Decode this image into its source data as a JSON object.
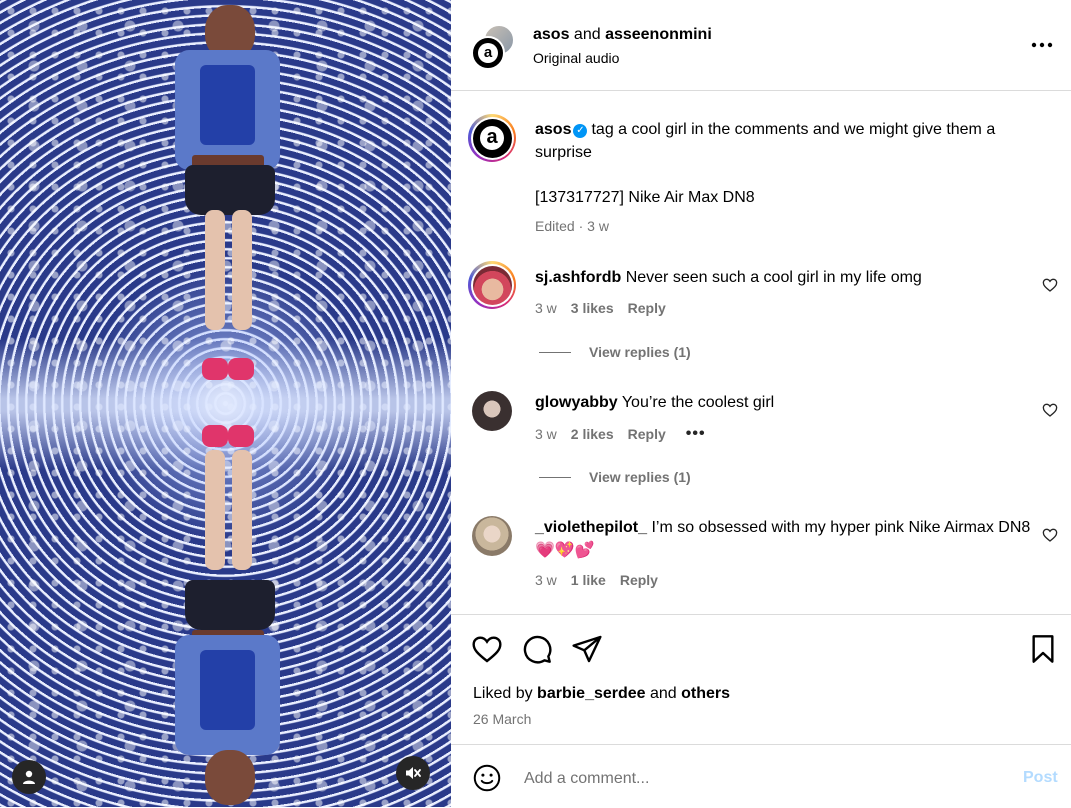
{
  "post_header": {
    "author_primary": "asos",
    "joiner": " and ",
    "author_secondary": "asseenonmini",
    "audio": "Original audio"
  },
  "caption": {
    "username": "asos",
    "text": "tag a cool girl in the comments and we might give them a surprise",
    "product": "[137317727] Nike Air Max DN8",
    "meta": "Edited · 3 w"
  },
  "comments": [
    {
      "username": "sj.ashfordb",
      "text": "Never seen such a cool girl in my life omg",
      "age": "3 w",
      "likes": "3 likes",
      "reply": "Reply",
      "view_replies": "View replies (1)"
    },
    {
      "username": "glowyabby",
      "text": "You’re the coolest girl",
      "age": "3 w",
      "likes": "2 likes",
      "reply": "Reply",
      "more": "•••",
      "view_replies": "View replies (1)"
    },
    {
      "username": "_violethepilot_",
      "text": "I’m so obsessed with my hyper pink Nike Airmax DN8💗💖💕",
      "age": "3 w",
      "likes": "1 like",
      "reply": "Reply"
    }
  ],
  "likes": {
    "prefix": "Liked by ",
    "user": "barbie_serdee",
    "joiner": " and ",
    "others": "others"
  },
  "date": "26 March",
  "composer": {
    "placeholder": "Add a comment...",
    "post_label": "Post"
  },
  "colors": {
    "link_blue": "#0095f6",
    "post_disabled": "#b3dbff",
    "muted_text": "#737373",
    "border": "#dbdbdb"
  },
  "icons": [
    "user-tag-icon",
    "muted-speaker-icon",
    "more-options-icon",
    "verified-badge-icon",
    "heart-icon",
    "comment-icon",
    "share-icon",
    "save-bookmark-icon",
    "emoji-icon"
  ]
}
